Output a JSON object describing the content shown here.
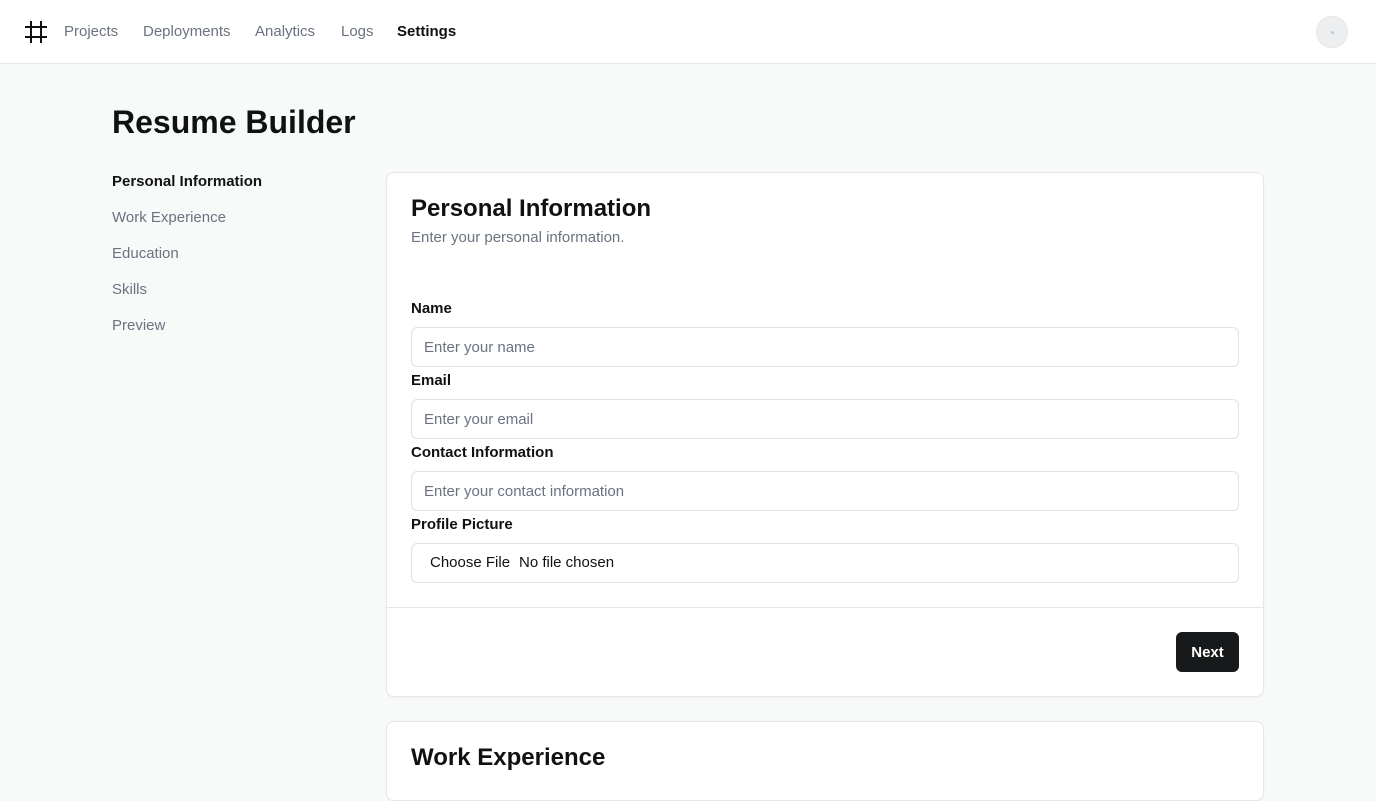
{
  "nav": {
    "logo_icon": "hash-icon",
    "links": [
      {
        "label": "Projects",
        "active": false
      },
      {
        "label": "Deployments",
        "active": false
      },
      {
        "label": "Analytics",
        "active": false
      },
      {
        "label": "Logs",
        "active": false
      },
      {
        "label": "Settings",
        "active": true
      }
    ],
    "avatar_icon": "avatar-icon"
  },
  "page": {
    "title": "Resume Builder"
  },
  "sidebar": {
    "items": [
      {
        "label": "Personal Information",
        "active": true
      },
      {
        "label": "Work Experience",
        "active": false
      },
      {
        "label": "Education",
        "active": false
      },
      {
        "label": "Skills",
        "active": false
      },
      {
        "label": "Preview",
        "active": false
      }
    ]
  },
  "personal_card": {
    "title": "Personal Information",
    "description": "Enter your personal information.",
    "fields": {
      "name": {
        "label": "Name",
        "placeholder": "Enter your name",
        "value": ""
      },
      "email": {
        "label": "Email",
        "placeholder": "Enter your email",
        "value": ""
      },
      "contact": {
        "label": "Contact Information",
        "placeholder": "Enter your contact information",
        "value": ""
      },
      "picture": {
        "label": "Profile Picture",
        "button_label": "Choose File",
        "status": "No file chosen"
      }
    },
    "next_label": "Next"
  },
  "work_card": {
    "title": "Work Experience"
  },
  "colors": {
    "background": "#f8f9f9",
    "primary_button": "#18191b",
    "muted_text": "#6b7280",
    "border": "#e4e6e9"
  }
}
